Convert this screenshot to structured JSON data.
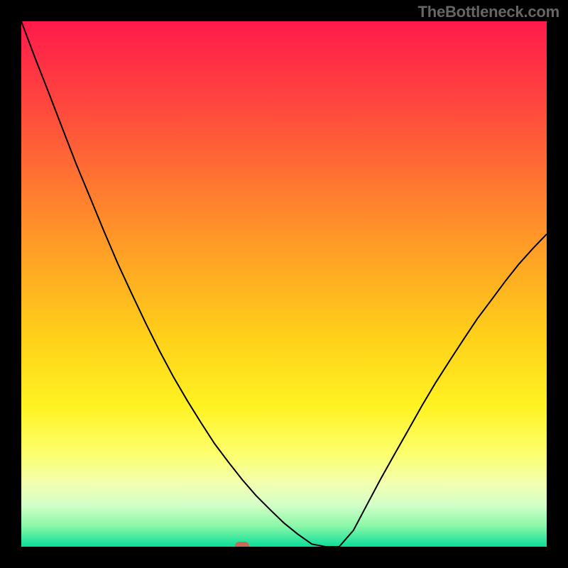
{
  "watermark": "TheBottleneck.com",
  "chart_data": {
    "type": "line",
    "title": "",
    "xlabel": "",
    "ylabel": "",
    "xlim": [
      0,
      100
    ],
    "ylim": [
      0,
      100
    ],
    "x": [
      0.0,
      2.6,
      5.3,
      7.9,
      10.5,
      13.2,
      15.8,
      18.4,
      21.1,
      23.7,
      26.3,
      28.9,
      31.6,
      34.2,
      36.8,
      39.5,
      42.1,
      44.7,
      47.4,
      50.0,
      52.6,
      55.3,
      57.9,
      60.5,
      63.2,
      65.8,
      68.4,
      71.1,
      73.7,
      76.3,
      78.9,
      81.6,
      84.2,
      86.8,
      89.5,
      92.1,
      94.7,
      97.4,
      100.0
    ],
    "values": [
      100.0,
      93.1,
      86.2,
      79.4,
      72.7,
      66.2,
      59.9,
      53.8,
      48.0,
      42.5,
      37.3,
      32.4,
      27.8,
      23.6,
      19.6,
      16.0,
      12.7,
      9.7,
      7.0,
      4.5,
      2.4,
      0.5,
      0.0,
      0.0,
      3.1,
      8.0,
      12.9,
      17.7,
      22.3,
      26.9,
      31.3,
      35.5,
      39.5,
      43.4,
      47.0,
      50.5,
      53.8,
      56.8,
      59.5
    ],
    "marker": {
      "x": 42,
      "y": 0
    },
    "background_gradient": {
      "type": "vertical",
      "stops": [
        {
          "pos": 0.0,
          "color": "#ff1a4b"
        },
        {
          "pos": 0.32,
          "color": "#ff7a30"
        },
        {
          "pos": 0.6,
          "color": "#ffd01a"
        },
        {
          "pos": 0.82,
          "color": "#fdff6a"
        },
        {
          "pos": 0.96,
          "color": "#8cf7a8"
        },
        {
          "pos": 1.0,
          "color": "#0bdf9a"
        }
      ]
    }
  }
}
